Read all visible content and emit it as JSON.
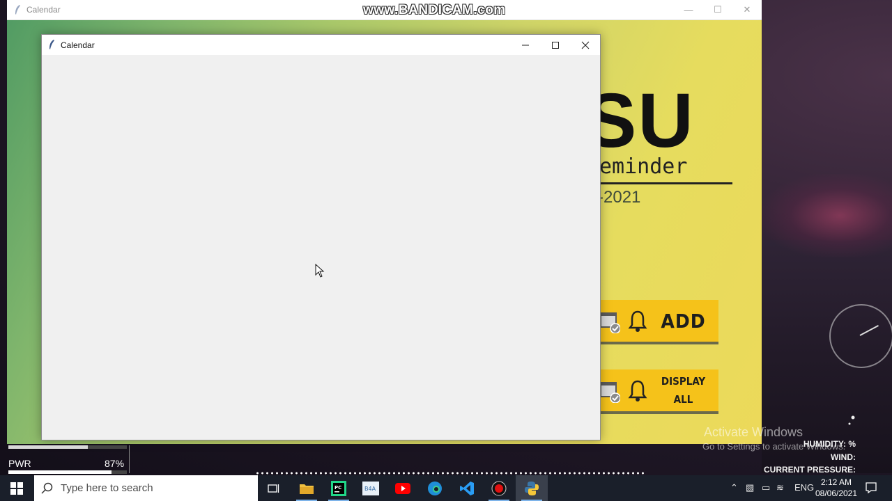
{
  "watermark": "www.BANDICAM.com",
  "background_window": {
    "title": "Calendar",
    "brand_text": "SU",
    "subtitle_text": "eminder",
    "year_text": "-2021",
    "buttons": [
      {
        "label": "ADD"
      },
      {
        "label_line1": "DISPLAY",
        "label_line2": "ALL"
      }
    ]
  },
  "dialog": {
    "title": "Calendar"
  },
  "desktop": {
    "activate_title": "Activate Windows",
    "activate_sub": "Go to Settings to activate Windows.",
    "weather": {
      "humidity": "HUMIDITY: %",
      "wind": "WIND:",
      "pressure": "CURRENT PRESSURE:"
    },
    "power": {
      "label": "PWR",
      "value": "87%",
      "level": 0.87
    }
  },
  "taskbar": {
    "search_placeholder": "Type here to search",
    "apps": [
      {
        "name": "task-view"
      },
      {
        "name": "file-explorer"
      },
      {
        "name": "pycharm"
      },
      {
        "name": "image-viewer",
        "text": "B4A"
      },
      {
        "name": "youtube"
      },
      {
        "name": "edge"
      },
      {
        "name": "vscode"
      },
      {
        "name": "bandicam"
      },
      {
        "name": "python"
      }
    ],
    "tray": {
      "language": "ENG",
      "time": "2:12 AM",
      "date": "08/06/2021"
    }
  },
  "colors": {
    "button_yellow": "#f5c21a",
    "taskbar": "#1a1f2a",
    "dialog_bg": "#f0f0f0"
  }
}
